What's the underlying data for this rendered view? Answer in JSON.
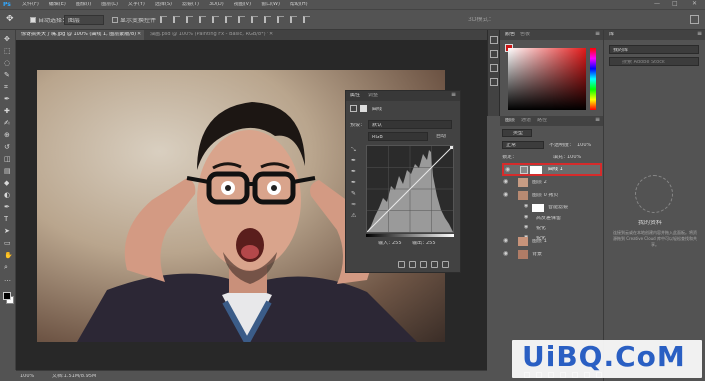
{
  "app": {
    "logo": "Ps"
  },
  "menubar": {
    "items": [
      "文件(F)",
      "编辑(E)",
      "图像(I)",
      "图层(L)",
      "文字(Y)",
      "选择(S)",
      "滤镜(T)",
      "3D(D)",
      "视图(V)",
      "窗口(W)",
      "帮助(H)"
    ]
  },
  "options": {
    "auto_select": "自动选择：",
    "target": "图层",
    "show_transform": "显示变换控件"
  },
  "tabs": [
    {
      "label": "惊讶搞笑大了嘴.jpg @ 100% (曲线 1, 图层蒙版/8) *",
      "active": true
    },
    {
      "label": "油画.psd @ 100% (Painting Fx - Basic, RGB/8*) *",
      "active": false
    }
  ],
  "status": {
    "zoom": "100%",
    "doc": "文档:1.51M/8.95M"
  },
  "properties": {
    "tabs": [
      "属性",
      "调整"
    ],
    "header": "曲线",
    "preset": "默认",
    "channel": "RGB",
    "auto": "自动",
    "input_label": "输入：",
    "input_value": "255",
    "output_label": "输出：",
    "output_value": "255"
  },
  "color_panel": {
    "tabs": [
      "颜色",
      "色板"
    ]
  },
  "layers_panel": {
    "tabs": [
      "图层",
      "通道",
      "路径"
    ],
    "filter": "类型",
    "blend": "正常",
    "opacity_label": "不透明度：",
    "opacity": "100%",
    "lock_label": "锁定：",
    "fill_label": "填充：",
    "fill": "100%",
    "layers": [
      {
        "name": "曲线 1",
        "selected": true
      },
      {
        "name": "图层 2"
      },
      {
        "name": "图层 0 拷贝"
      },
      {
        "name": "智能滤镜"
      },
      {
        "name": "高反差保留"
      },
      {
        "name": "锐化"
      },
      {
        "name": "锐化"
      },
      {
        "name": "图层 1"
      },
      {
        "name": "背景"
      }
    ]
  },
  "libraries": {
    "tab": "库",
    "dropdown": "我的库",
    "search": "搜索 Adobe Stock",
    "title": "我的资料",
    "desc": "连接到云或在本地创建内容并拖入此面板。将资源拖到 Creative Cloud 库中可以轻松查找和共享。"
  },
  "colors": {
    "selection": "#d62b2b",
    "hue": "#cc1616",
    "chrome": "#535353",
    "panel": "#3d3d3d"
  },
  "watermark": "UiBQ.CoM"
}
